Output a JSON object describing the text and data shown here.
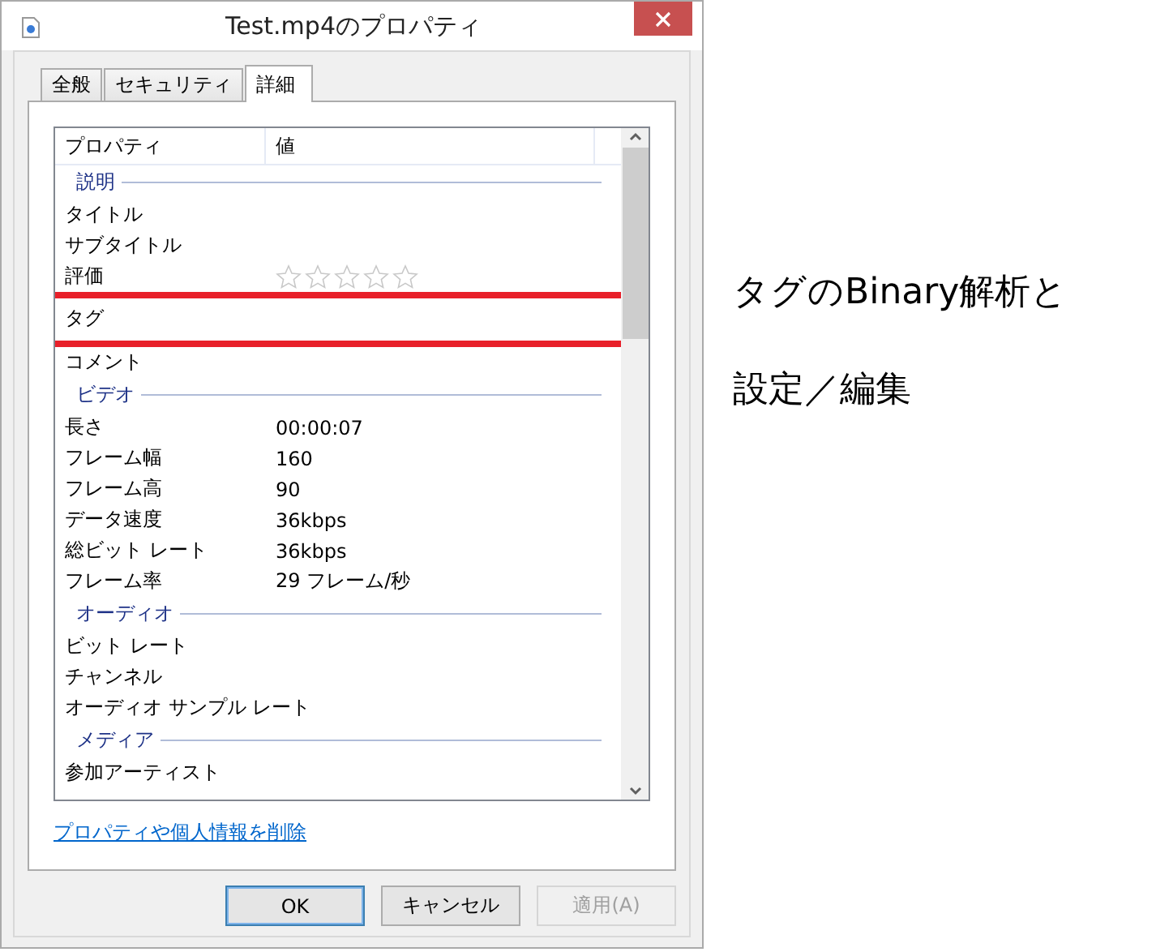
{
  "window": {
    "title": "Test.mp4のプロパティ"
  },
  "tabs": [
    {
      "label": "全般",
      "selected": false
    },
    {
      "label": "セキュリティ",
      "selected": false
    },
    {
      "label": "詳細",
      "selected": true
    }
  ],
  "table": {
    "columns": [
      "プロパティ",
      "値"
    ],
    "sections": [
      {
        "heading": "説明",
        "rows": [
          {
            "kind": "text",
            "name": "タイトル",
            "highlighted": false
          },
          {
            "kind": "text",
            "name": "サブタイトル",
            "highlighted": false
          },
          {
            "kind": "stars",
            "name": "評価",
            "stars": 0,
            "highlighted": false
          },
          {
            "kind": "text",
            "name": "タグ",
            "highlighted": true
          },
          {
            "kind": "text",
            "name": "コメント",
            "highlighted": false
          }
        ]
      },
      {
        "heading": "ビデオ",
        "rows": [
          {
            "kind": "text",
            "name": "長さ",
            "value": "00:00:07",
            "highlighted": false
          },
          {
            "kind": "text",
            "name": "フレーム幅",
            "value": "160",
            "highlighted": false
          },
          {
            "kind": "text",
            "name": "フレーム高",
            "value": "90",
            "highlighted": false
          },
          {
            "kind": "text",
            "name": "データ速度",
            "value": "36kbps",
            "highlighted": false
          },
          {
            "kind": "text",
            "name": "総ビット レート",
            "value": "36kbps",
            "highlighted": false
          },
          {
            "kind": "text",
            "name": "フレーム率",
            "value": "29 フレーム/秒",
            "highlighted": false
          }
        ]
      },
      {
        "heading": "オーディオ",
        "rows": [
          {
            "kind": "text",
            "name": "ビット レート",
            "highlighted": false
          },
          {
            "kind": "text",
            "name": "チャンネル",
            "highlighted": false
          },
          {
            "kind": "text",
            "name": "オーディオ サンプル レート",
            "highlighted": false
          }
        ]
      },
      {
        "heading": "メディア",
        "rows": [
          {
            "kind": "text",
            "name": "参加アーティスト",
            "highlighted": false
          }
        ]
      }
    ]
  },
  "link": "プロパティや個人情報を削除",
  "buttons": [
    {
      "label": "OK",
      "default": true,
      "disabled": false
    },
    {
      "label": "キャンセル",
      "default": false,
      "disabled": false
    },
    {
      "label": "適用(A)",
      "default": false,
      "disabled": true
    }
  ],
  "annotation": [
    "タグのBinary解析と",
    "設定／編集"
  ]
}
